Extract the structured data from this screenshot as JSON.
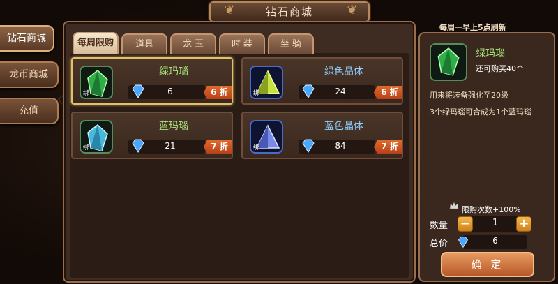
{
  "window_title": "钻石商城",
  "sidebar": {
    "items": [
      {
        "label": "钻石商城"
      },
      {
        "label": "龙币商城"
      },
      {
        "label": "充值"
      }
    ]
  },
  "tabs": [
    {
      "label": "每周限购"
    },
    {
      "label": "道具"
    },
    {
      "label": "龙 玉"
    },
    {
      "label": "时 装"
    },
    {
      "label": "坐 骑"
    }
  ],
  "items": [
    {
      "name": "绿玛瑙",
      "bind": "绑",
      "price": "6",
      "discount": "6 折",
      "name_color": "#a6e37a",
      "icon": "green-gem-icon"
    },
    {
      "name": "绿色晶体",
      "bind": "绑",
      "price": "24",
      "discount": "6 折",
      "name_color": "#8ed0ff",
      "icon": "green-crystal-icon"
    },
    {
      "name": "蓝玛瑙",
      "bind": "绑",
      "price": "21",
      "discount": "7 折",
      "name_color": "#a6e37a",
      "icon": "blue-gem-icon"
    },
    {
      "name": "蓝色晶体",
      "bind": "绑",
      "price": "84",
      "discount": "7 折",
      "name_color": "#8ed0ff",
      "icon": "blue-crystal-icon"
    }
  ],
  "detail": {
    "refresh_note": "每周一早上5点刷新",
    "name": "绿玛瑙",
    "limit": "还可购买40个",
    "desc1": "用来将装备强化至20级",
    "desc2": "3个绿玛瑙可合成为1个蓝玛瑙",
    "limit_bonus": "限购次数+100%",
    "qty_label": "数量",
    "qty_minus": "−",
    "qty_value": "1",
    "qty_plus": "+",
    "total_label": "总价",
    "total_value": "6",
    "confirm": "确 定"
  }
}
